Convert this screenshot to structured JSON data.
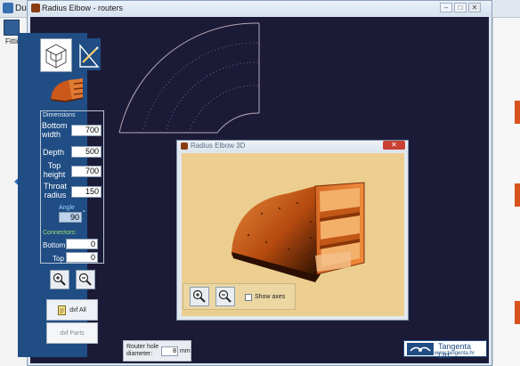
{
  "host": {
    "title_fragment": "Duc",
    "fittings_label": "Fittings"
  },
  "window": {
    "title": "Radius Elbow - routers",
    "buttons": [
      "–",
      "□",
      "✕"
    ]
  },
  "panel": {
    "section_dimensions": "Dimensions",
    "fields": [
      {
        "label": "Bottom width",
        "value": "700"
      },
      {
        "label": "Depth",
        "value": "500"
      },
      {
        "label": "Top height",
        "value": "700"
      },
      {
        "label": "Throat radius",
        "value": "150"
      }
    ],
    "angle_label": "Angle",
    "angle_value": "90",
    "angle_unit": "°",
    "section_connectors": "Connectors:",
    "connectors": [
      {
        "label": "Bottom",
        "value": "0"
      },
      {
        "label": "Top",
        "value": "0"
      }
    ],
    "dxf_all_label": "dxf All",
    "dxf_parts_label": "dxf Parts",
    "router_label": "Router hole diameter:",
    "router_value": "8",
    "router_unit": "mm"
  },
  "dialog": {
    "title": "Radius Elbow 3D",
    "show_axes_label": "Show axes",
    "show_axes_checked": false
  },
  "logo": {
    "name": "Tangenta Ltd.",
    "url": "www.tangenta.hr"
  },
  "colors": {
    "canvas": "#1c1b37",
    "panel": "#1f4d84",
    "viewport": "#eccf90",
    "model": "#d2691e"
  }
}
